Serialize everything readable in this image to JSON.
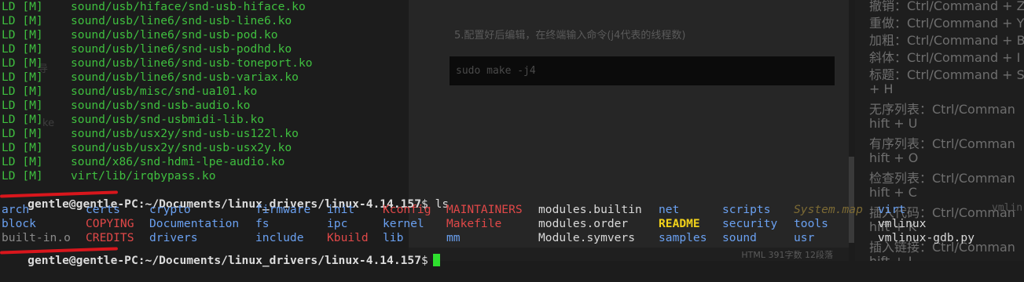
{
  "background_doc": {
    "step_text": "5.配置好后编辑，在终端输入命令(j4代表的线程数)",
    "code_text": "sudo make -j4",
    "status_text": "HTML 391字数 12段落",
    "left_fragment_1": "导",
    "left_fragment_2": "ke",
    "right_fragment": "vmlin",
    "cheatsheet": [
      "撤销：Ctrl/Command + Z",
      "重做：Ctrl/Command + Y",
      "加粗：Ctrl/Command + B",
      "斜体：Ctrl/Command + I",
      "标题：Ctrl/Command + S",
      "+ H",
      "无序列表：Ctrl/Comman",
      "hift + U",
      "有序列表：Ctrl/Comman",
      "hift + O",
      "检查列表：Ctrl/Comman",
      "hift + C",
      "插入代码：Ctrl/Comman",
      "hift + K",
      "插入链接：Ctrl/Comman",
      "hift + L"
    ]
  },
  "terminal": {
    "ld_lines": [
      {
        "tag": "LD [M]",
        "path": "sound/usb/hiface/snd-usb-hiface.ko"
      },
      {
        "tag": "LD [M]",
        "path": "sound/usb/line6/snd-usb-line6.ko"
      },
      {
        "tag": "LD [M]",
        "path": "sound/usb/line6/snd-usb-pod.ko"
      },
      {
        "tag": "LD [M]",
        "path": "sound/usb/line6/snd-usb-podhd.ko"
      },
      {
        "tag": "LD [M]",
        "path": "sound/usb/line6/snd-usb-toneport.ko"
      },
      {
        "tag": "LD [M]",
        "path": "sound/usb/line6/snd-usb-variax.ko"
      },
      {
        "tag": "LD [M]",
        "path": "sound/usb/misc/snd-ua101.ko"
      },
      {
        "tag": "LD [M]",
        "path": "sound/usb/snd-usb-audio.ko"
      },
      {
        "tag": "LD [M]",
        "path": "sound/usb/snd-usbmidi-lib.ko"
      },
      {
        "tag": "LD [M]",
        "path": "sound/usb/usx2y/snd-usb-us122l.ko"
      },
      {
        "tag": "LD [M]",
        "path": "sound/usb/usx2y/snd-usb-usx2y.ko"
      },
      {
        "tag": "LD [M]",
        "path": "sound/x86/snd-hdmi-lpe-audio.ko"
      },
      {
        "tag": "LD [M]",
        "path": "virt/lib/irqbypass.ko"
      }
    ],
    "prompt1": {
      "user": "gentle@gentle-PC",
      "path": ":~/Documents/linux_drivers/linux-4.14.157",
      "symbol": "$",
      "command": " ls"
    },
    "ls_rows": [
      [
        "arch",
        "certs",
        "crypto",
        "firmware",
        "init",
        "Kconfig",
        "MAINTAINERS",
        "modules.builtin",
        "net",
        "scripts",
        "System.map",
        "virt"
      ],
      [
        "block",
        "COPYING",
        "Documentation",
        "fs",
        "ipc",
        "kernel",
        "Makefile",
        "modules.order",
        "README",
        "security",
        "tools",
        "vmlinux"
      ],
      [
        "built-in.o",
        "CREDITS",
        "drivers",
        "include",
        "Kbuild",
        "lib",
        "mm",
        "Module.symvers",
        "samples",
        "sound",
        "usr",
        "vmlinux-gdb.py"
      ]
    ],
    "prompt2": {
      "user": "gentle@gentle-PC",
      "path": ":~/Documents/linux_drivers/linux-4.14.157",
      "symbol": "$",
      "command": ""
    },
    "colors": {
      "ld_green": "#3fbf3f",
      "dir_blue": "#6aa0f0",
      "file_white": "#d9d9d9",
      "red": "#e04848",
      "readme_yellow": "#f2d21a",
      "sysmap_italic": "#7c6a34",
      "cursor_green": "#2ee02e",
      "redaction_red": "#d8161c"
    }
  }
}
